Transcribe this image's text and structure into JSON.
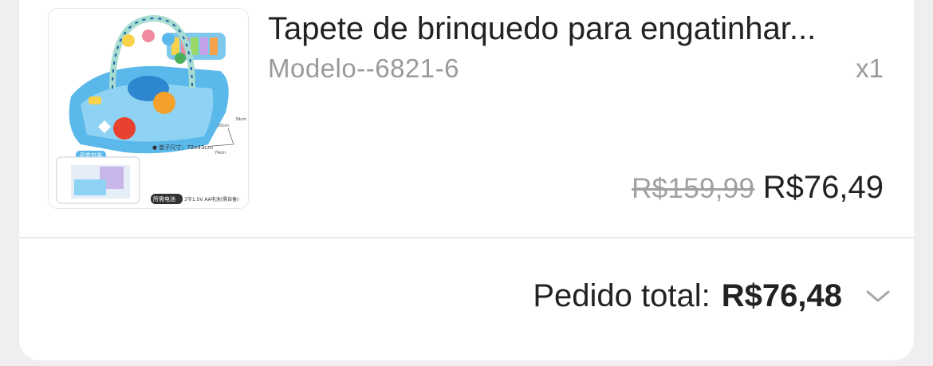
{
  "item": {
    "title": "Tapete de brinquedo para engatinhar...",
    "variant": "Modelo--6821-6",
    "quantity": "x1",
    "original_price": "R$159,99",
    "price": "R$76,49",
    "image_icon": "baby-play-mat-image",
    "image_text": {
      "box_label": "彩盒包装",
      "size_label": "● 垫子尺寸：72x43cm",
      "battery_badge": "所需电池",
      "battery_text": "3节1.5V AA电池(需自备)",
      "dim_h": "55cm",
      "dim_w": "74cm",
      "dim_d": "39cm"
    }
  },
  "order": {
    "total_label": "Pedido total:",
    "total_value": "R$76,48",
    "expand_icon": "chevron-down-icon"
  },
  "colors": {
    "page_bg": "#efeff2",
    "card_bg": "#ffffff",
    "text_primary": "#222222",
    "text_secondary": "#9a9a9a"
  }
}
